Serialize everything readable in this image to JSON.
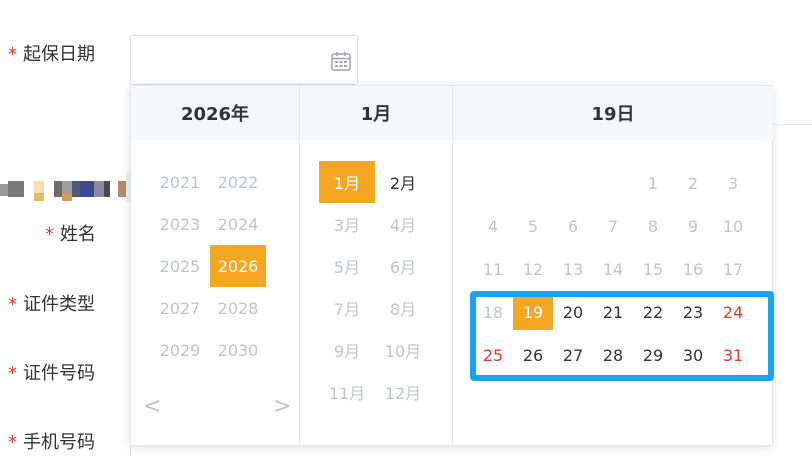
{
  "form": {
    "required_mark": "*",
    "start_date_label": "起保日期",
    "name_label": "姓名",
    "id_type_label": "证件类型",
    "id_number_label": "证件号码",
    "phone_label": "手机号码"
  },
  "picker": {
    "year_header": "2026年",
    "month_header": "1月",
    "day_header": "19日",
    "years": [
      "2021",
      "2022",
      "2023",
      "2024",
      "2025",
      "2026",
      "2027",
      "2028",
      "2029",
      "2030"
    ],
    "selected_year": "2026",
    "months": [
      "1月",
      "2月",
      "3月",
      "4月",
      "5月",
      "6月",
      "7月",
      "8月",
      "9月",
      "10月",
      "11月",
      "12月"
    ],
    "selected_month": "1月",
    "prev_arrow": "<",
    "next_arrow": ">",
    "days": [
      [
        "",
        "",
        "",
        "",
        "1",
        "2",
        "3"
      ],
      [
        "4",
        "5",
        "6",
        "7",
        "8",
        "9",
        "10"
      ],
      [
        "11",
        "12",
        "13",
        "14",
        "15",
        "16",
        "17"
      ],
      [
        "18",
        "19",
        "20",
        "21",
        "22",
        "23",
        "24"
      ],
      [
        "25",
        "26",
        "27",
        "28",
        "29",
        "30",
        "31"
      ]
    ],
    "selected_day": "19",
    "colors": {
      "accent": "#f5a623",
      "highlight": "#1aa3ee",
      "weekend": "#e53935"
    }
  }
}
